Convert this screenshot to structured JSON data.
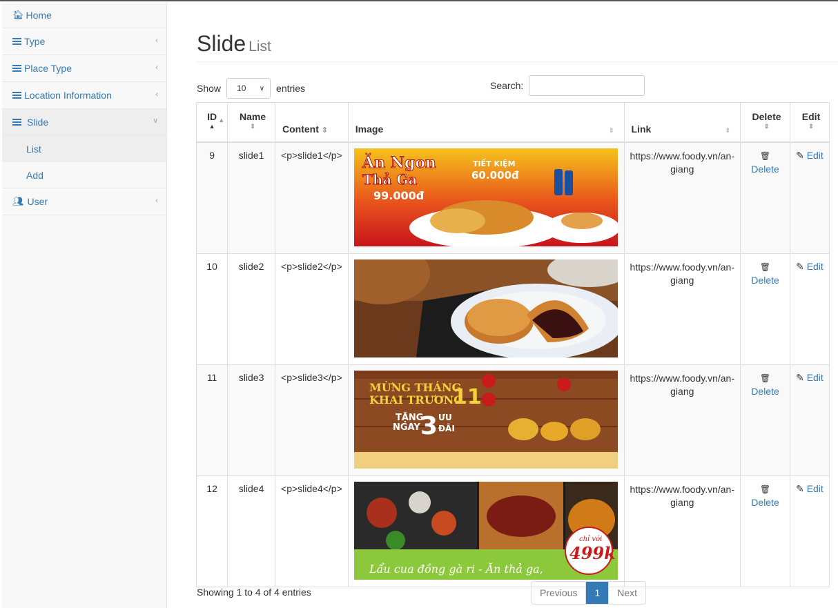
{
  "sidebar": {
    "home": "Home",
    "type": "Type",
    "place_type": "Place Type",
    "location": "Location Information",
    "slide": "Slide",
    "slide_list": "List",
    "slide_add": "Add",
    "user": "User"
  },
  "page": {
    "title": "Slide",
    "subtitle": "List"
  },
  "controls": {
    "show": "Show",
    "entries_value": "10",
    "entries": "entries",
    "search": "Search:",
    "search_value": ""
  },
  "table": {
    "headers": {
      "id": "ID",
      "name": "Name",
      "content": "Content",
      "image": "Image",
      "link": "Link",
      "delete": "Delete",
      "edit": "Edit"
    },
    "rows": [
      {
        "id": "9",
        "name": "slide1",
        "content": "<p>slide1</p>",
        "link1": "https://www.foody.vn/an-",
        "link2": "giang",
        "delete": "Delete",
        "edit": "Edit"
      },
      {
        "id": "10",
        "name": "slide2",
        "content": "<p>slide2</p>",
        "link1": "https://www.foody.vn/an-",
        "link2": "giang",
        "delete": "Delete",
        "edit": "Edit"
      },
      {
        "id": "11",
        "name": "slide3",
        "content": "<p>slide3</p>",
        "link1": "https://www.foody.vn/an-",
        "link2": "giang",
        "delete": "Delete",
        "edit": "Edit"
      },
      {
        "id": "12",
        "name": "slide4",
        "content": "<p>slide4</p>",
        "link1": "https://www.foody.vn/an-",
        "link2": "giang",
        "delete": "Delete",
        "edit": "Edit"
      }
    ]
  },
  "banners": {
    "b1_line1": "Ăn Ngon",
    "b1_line2": "Thả Ga",
    "b1_price": "99.000đ",
    "b1_save1": "TIẾT KIỆM",
    "b1_save2": "60.000đ",
    "b3_line1": "MỪNG THÁNG",
    "b3_line2": "KHAI TRƯƠNG",
    "b3_num": "11",
    "b3_gift1": "TẶNG",
    "b3_gift2": "NGAY",
    "b3_three": "3",
    "b3_uu": "ƯU",
    "b3_dai": "ĐÃI",
    "b4_slogan": "Lẩu cua đồng gà ri - Ăn thả ga,",
    "b4_chi": "chỉ với",
    "b4_price": "499k"
  },
  "footer": {
    "info": "Showing 1 to 4 of 4 entries",
    "prev": "Previous",
    "page": "1",
    "next": "Next"
  },
  "colors": {
    "link": "#337ab7",
    "active_page": "#337ab7"
  }
}
